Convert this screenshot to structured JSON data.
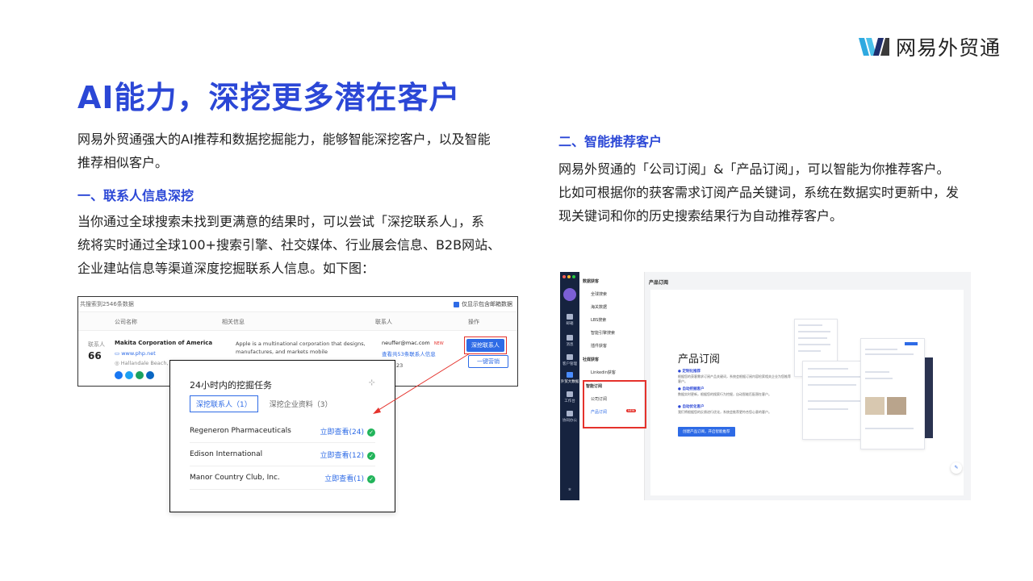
{
  "brand": {
    "name": "网易外贸通"
  },
  "title": "AI能力，深挖更多潜在客户",
  "left": {
    "intro": [
      "网易外贸通强大的AI推荐和数据挖掘能力，能够智能深挖客户，以及智能",
      "推荐相似客户。"
    ],
    "section1_heading": "一、联系人信息深挖",
    "section1_body": [
      "当你通过全球搜索未找到更满意的结果时，可以尝试「深挖联系人」，系",
      "统将实时通过全球100+搜索引擎、社交媒体、行业展会信息、B2B网站、",
      "企业建站信息等渠道深度挖掘联系人信息。如下图："
    ]
  },
  "right": {
    "section2_heading": "二、智能推荐客户",
    "section2_body": [
      "网易外贸通的「公司订阅」&「产品订阅」，可以智能为你推荐客户。",
      "比如可根据你的获客需求订阅产品关键词，系统在数据实时更新中，发",
      "现关键词和你的历史搜索结果行为自动推荐客户。"
    ]
  },
  "shot1": {
    "count_text": "共搜索到2546条数据",
    "checkbox_label": "仅显示包含邮箱数据",
    "col_company": "公司名称",
    "col_info": "相关信息",
    "col_contact": "联系人",
    "col_action": "操作",
    "row_contacts_label": "联系人",
    "row_contacts_count": "66",
    "company_name": "Makita Corporation of America",
    "website": "www.php.net",
    "location": "Hallandale Beach, F",
    "info_line1": "Apple is a multinational corporation that designs,",
    "info_line2": "manufactures, and markets mobile",
    "email": "neuffer@mac.com",
    "new_badge": "NEW",
    "view_contacts": "查看共53条联系人信息",
    "stat1": "0",
    "stat2": "23",
    "btn_dig": "深挖联系人",
    "btn_market": "一键营销"
  },
  "popup": {
    "title": "24小时内的挖掘任务",
    "tab1": "深挖联系人（1）",
    "tab2": "深挖企业资料（3）",
    "rows": [
      {
        "name": "Regeneron Pharmaceuticals",
        "action": "立即查看(24)"
      },
      {
        "name": "Edison International",
        "action": "立即查看(12)"
      },
      {
        "name": "Manor Country Club, Inc.",
        "action": "立即查看(1)"
      }
    ]
  },
  "shot2": {
    "page_title": "产品订阅",
    "rail": [
      "邮箱",
      "消息",
      "客户管理",
      "外贸大数据",
      "工作台",
      "协同办公"
    ],
    "sidebar": {
      "group1": "数据获客",
      "g1_items": [
        "全球搜索",
        "海关数据",
        "LBS搜索",
        "智能引擎搜索",
        "插件获客"
      ],
      "group2": "社媒获客",
      "g2_items": [
        "Linkedin获客"
      ],
      "group3": "智能订阅",
      "g3_items": [
        "公司订阅",
        "产品订阅"
      ],
      "badge": "NEW"
    },
    "panel_title": "产品订阅",
    "features": [
      {
        "title": "● 定制化推荐",
        "desc": "根据您的获客需求订阅产品关键词，系统会根据订阅内容检索相关企业为您推荐客户。"
      },
      {
        "title": "● 自动挖掘客户",
        "desc": "数据实时更新，根据您的搜索行为挖掘，自动智能匹配潜在客户。"
      },
      {
        "title": "● 自动优化客户",
        "desc": "我们将根据您的反馈进行优化，系统会推荐更符合您心意的客户。"
      }
    ],
    "cta": "创建产品订阅，开启智能推荐"
  },
  "colors": {
    "accent": "#2b47d6",
    "button": "#2e6be6",
    "highlight": "#e5322c"
  }
}
